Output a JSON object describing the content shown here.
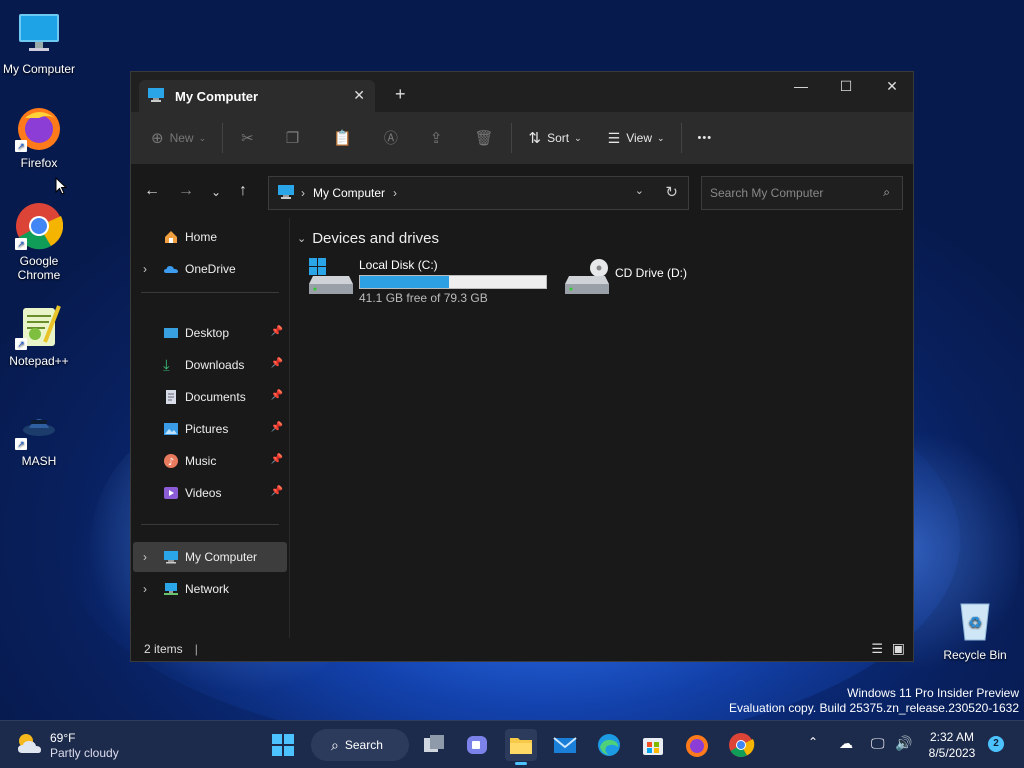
{
  "desktop": {
    "icons": [
      {
        "label": "My Computer"
      },
      {
        "label": "Firefox"
      },
      {
        "label": "Google Chrome"
      },
      {
        "label": "Notepad++"
      },
      {
        "label": "MASH"
      },
      {
        "label": "Recycle Bin"
      }
    ],
    "watermark_line1": "Windows 11 Pro Insider Preview",
    "watermark_line2": "Evaluation copy. Build 25375.zn_release.230520-1632"
  },
  "window": {
    "tab_title": "My Computer",
    "new_tab": "+",
    "minimize": "—",
    "maximize": "☐",
    "close": "✕",
    "toolbar": {
      "new_label": "New",
      "sort_label": "Sort",
      "view_label": "View",
      "more_label": "•••"
    },
    "address": {
      "location": "My Computer",
      "search_placeholder": "Search My Computer"
    },
    "sidebar": {
      "home": "Home",
      "onedrive": "OneDrive",
      "quick": [
        {
          "label": "Desktop"
        },
        {
          "label": "Downloads"
        },
        {
          "label": "Documents"
        },
        {
          "label": "Pictures"
        },
        {
          "label": "Music"
        },
        {
          "label": "Videos"
        }
      ],
      "my_computer": "My Computer",
      "network": "Network"
    },
    "content": {
      "group_title": "Devices and drives",
      "drives": [
        {
          "name": "Local Disk (C:)",
          "space": "41.1 GB free of 79.3 GB",
          "used_fraction": 0.48
        },
        {
          "name": "CD Drive (D:)"
        }
      ]
    },
    "status": {
      "items": "2 items"
    }
  },
  "taskbar": {
    "weather_temp": "69°F",
    "weather_desc": "Partly cloudy",
    "search_label": "Search",
    "time": "2:32 AM",
    "date": "8/5/2023",
    "notifications": "2"
  },
  "colors": {
    "accent": "#2d9fe3",
    "window_bg": "#191919",
    "toolbar_bg": "#2c2c2c",
    "taskbar_bg": "#1c2b4b"
  }
}
